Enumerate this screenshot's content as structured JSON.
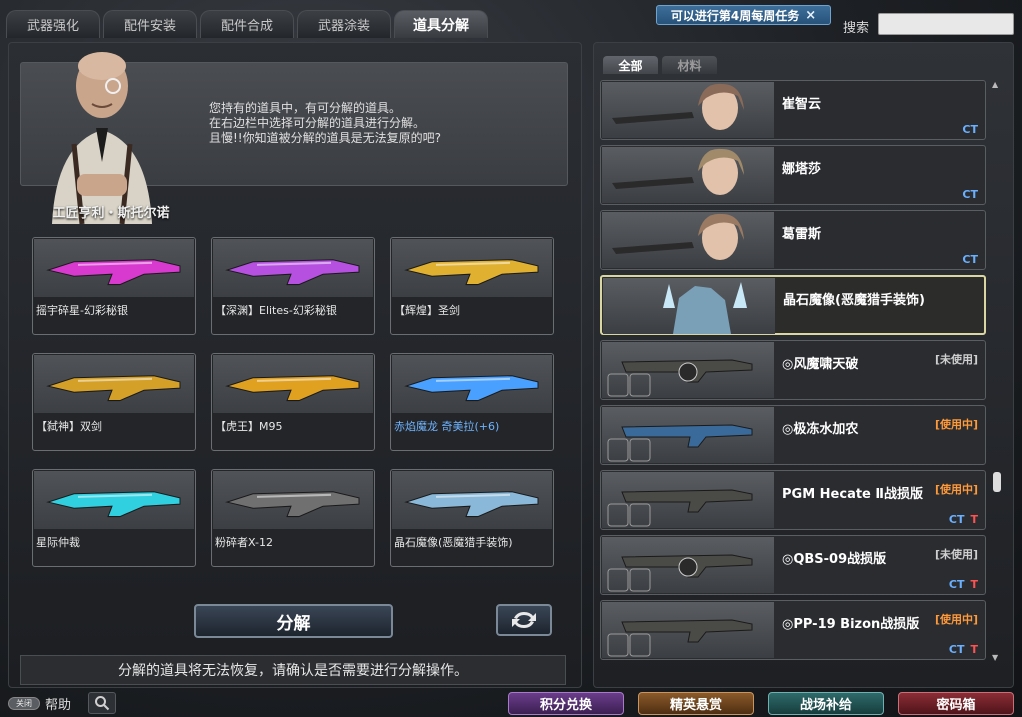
{
  "top_tabs": [
    {
      "label": "武器强化"
    },
    {
      "label": "配件安装"
    },
    {
      "label": "配件合成"
    },
    {
      "label": "武器涂装"
    },
    {
      "label": "道具分解"
    }
  ],
  "weekly_banner": {
    "text": "可以进行第4周每周任务",
    "close": "×"
  },
  "search": {
    "label": "搜索",
    "value": ""
  },
  "npc": {
    "name": "工匠亨利・斯托尔诺",
    "lines": [
      "您持有的道具中，有可分解的道具。",
      "在右边栏中选择可分解的道具进行分解。",
      "且慢!!你知道被分解的道具是无法复原的吧?"
    ]
  },
  "items": [
    {
      "label": "摇宇碎星-幻彩秘银",
      "color": "#d83ad0"
    },
    {
      "label": "【深渊】Elites-幻彩秘银",
      "color": "#b550e0"
    },
    {
      "label": "【辉煌】圣剑",
      "color": "#e0b030"
    },
    {
      "label": "【弑神】双剑",
      "color": "#d4a028"
    },
    {
      "label": "【虎王】M95",
      "color": "#e0a020"
    },
    {
      "label": "赤焰魔龙 奇美拉(+6)",
      "color": "#4aa0ff"
    },
    {
      "label": "星际仲裁",
      "color": "#30d0e0"
    },
    {
      "label": "粉碎者X-12",
      "color": "#707070"
    },
    {
      "label": "晶石魔像(恶魔猎手装饰)",
      "color": "#8ab8d8"
    }
  ],
  "decompose_button": "分解",
  "warning": "分解的道具将无法恢复，请确认是否需要进行分解操作。",
  "right_tabs": [
    {
      "label": "全部"
    },
    {
      "label": "材料"
    }
  ],
  "list_items": [
    {
      "name": "崔智云",
      "status": "",
      "ct": "CT",
      "t": ""
    },
    {
      "name": "娜塔莎",
      "status": "",
      "ct": "CT",
      "t": ""
    },
    {
      "name": "葛雷斯",
      "status": "",
      "ct": "CT",
      "t": ""
    },
    {
      "name": "晶石魔像(恶魔猎手装饰)",
      "status": "",
      "ct": "",
      "t": ""
    },
    {
      "name": "◎风魔啸天破",
      "status": "[未使用]",
      "ct": "",
      "t": ""
    },
    {
      "name": "◎极冻水加农",
      "status": "[使用中]",
      "ct": "",
      "t": ""
    },
    {
      "name": "PGM Hecate Ⅱ战损版",
      "status": "[使用中]",
      "ct": "CT",
      "t": "T"
    },
    {
      "name": "◎QBS-09战损版",
      "status": "[未使用]",
      "ct": "CT",
      "t": "T"
    },
    {
      "name": "◎PP-19 Bizon战损版",
      "status": "[使用中]",
      "ct": "CT",
      "t": "T"
    }
  ],
  "bottom": {
    "help_toggle": "关闭",
    "help": "帮助",
    "buttons": [
      "积分兑换",
      "精英悬赏",
      "战场补给",
      "密码箱"
    ]
  }
}
